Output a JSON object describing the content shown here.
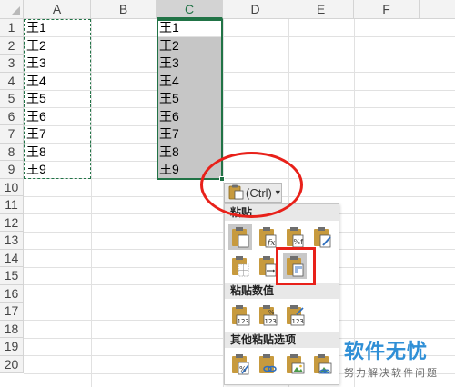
{
  "columns": [
    "A",
    "B",
    "C",
    "D",
    "E",
    "F"
  ],
  "rows": [
    "1",
    "2",
    "3",
    "4",
    "5",
    "6",
    "7",
    "8",
    "9",
    "10",
    "11",
    "12",
    "13",
    "14",
    "15",
    "16",
    "17",
    "18",
    "19",
    "20"
  ],
  "column_a": [
    "王1",
    "王2",
    "王3",
    "王4",
    "王5",
    "王6",
    "王7",
    "王8",
    "王9"
  ],
  "column_c": [
    "王1",
    "王2",
    "王3",
    "王4",
    "王5",
    "王6",
    "王7",
    "王8",
    "王9"
  ],
  "paste_button": {
    "label": "(Ctrl)"
  },
  "paste_menu": {
    "section_paste": "粘贴",
    "section_values": "粘贴数值",
    "section_other": "其他粘贴选项"
  },
  "watermark": {
    "title": "软件无忧",
    "subtitle": "努力解决软件问题"
  },
  "colors": {
    "selection_green": "#217346",
    "highlight": "#c6c6c6",
    "annotation_red": "#e8211a",
    "watermark_blue": "#2f8fd6"
  }
}
